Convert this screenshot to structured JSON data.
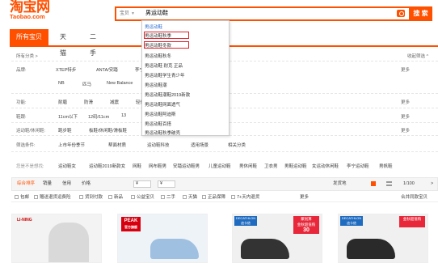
{
  "logo": {
    "cn": "淘宝网",
    "en": "Taobao.com"
  },
  "search": {
    "scope": "宝贝",
    "value": "男运动鞋",
    "button": "搜 索"
  },
  "tabs": [
    "所有宝贝",
    "天猫",
    "二手"
  ],
  "breadcrumb": "所有分类 >",
  "collapse": "收起筛选 ^",
  "filters": {
    "brand_label": "品牌:",
    "brands_row1": [
      "XTEP特步",
      "ANTA/安踏",
      "李宁"
    ],
    "brands_row2": [
      "NB",
      "匹马",
      "New Balance"
    ],
    "func_label": "功能:",
    "funcs": [
      "耐磨",
      "防滑",
      "减震",
      "轻便"
    ],
    "heel_label": "鞋跟:",
    "heels": [
      "11cm以下",
      "12码/11cm",
      "13"
    ],
    "style_label": "运动鞋/休闲鞋:",
    "styles": [
      "跑步鞋",
      "板鞋/休闲鞋/滑板鞋"
    ],
    "filter_label": "筛选条件:",
    "filter_items": [
      "上市年份季节",
      "帮面材质",
      "运动鞋科技",
      "适用场景",
      "相关分类"
    ],
    "more": "更多"
  },
  "related": {
    "label": "您是不是想找:",
    "items": [
      "运动鞋女",
      "运动鞋2019新款女",
      "网鞋",
      "网布鞋男",
      "安踏运动鞋男",
      "儿童运动鞋",
      "男休闲鞋",
      "卫衣男",
      "男鞋运动鞋",
      "女运动休闲鞋",
      "李宁运动鞋",
      "男帆鞋"
    ]
  },
  "dropdown": {
    "items": [
      "男运动鞋",
      "男运动鞋秋季",
      "男运动鞋冬款",
      "男运动鞋秋冬",
      "男运动鞋 耐克 正品",
      "男运动鞋学生青少年",
      "男运动鞋潮",
      "男运动鞋潮鞋2019新款",
      "男运动鞋网面透气",
      "男运动鞋阿迪斯",
      "男运动鞋百搭",
      "男运动鞋秋季破壳"
    ]
  },
  "sort": {
    "items": [
      "综合排序",
      "销量",
      "信用",
      "价格"
    ],
    "price_from": "¥",
    "price_to": "¥",
    "ship": "发货地",
    "page": "1/100",
    "next": ">"
  },
  "checks": [
    "包邮",
    "赠送退货运费险",
    "货到付款",
    "新品",
    "公益宝贝",
    "二手",
    "天猫",
    "正品保障",
    "7+天内退货"
  ],
  "more2": "更多",
  "combine": "合并同款宝贝",
  "ads": [
    {
      "brand": "LI-NING"
    },
    {
      "brand": "PEAK",
      "sub": "官方旗舰"
    },
    {
      "brand": "DECATHLON",
      "sub": "迪卡侬"
    },
    {
      "brand": "DECATHLON",
      "sub": "迪卡侬"
    }
  ],
  "ad_badges": [
    "聚划算",
    "金秋超值购",
    "30",
    "金秋超值购"
  ]
}
